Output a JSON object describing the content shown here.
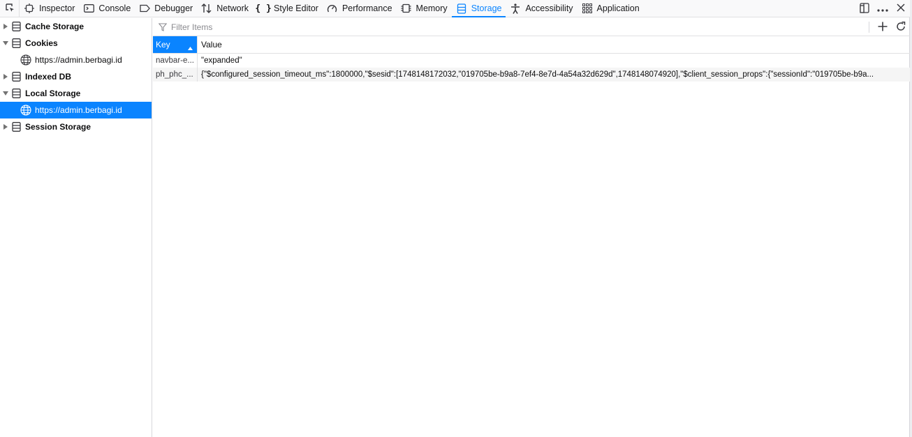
{
  "toolbar": {
    "tabs": [
      {
        "label": "Inspector",
        "icon": "inspector-icon"
      },
      {
        "label": "Console",
        "icon": "console-icon"
      },
      {
        "label": "Debugger",
        "icon": "debugger-icon"
      },
      {
        "label": "Network",
        "icon": "network-icon"
      },
      {
        "label": "Style Editor",
        "icon": "style-editor-icon"
      },
      {
        "label": "Performance",
        "icon": "performance-icon"
      },
      {
        "label": "Memory",
        "icon": "memory-icon"
      },
      {
        "label": "Storage",
        "icon": "storage-icon",
        "active": true
      },
      {
        "label": "Accessibility",
        "icon": "accessibility-icon"
      },
      {
        "label": "Application",
        "icon": "application-icon"
      }
    ],
    "accent_color": "#0a84ff"
  },
  "sidebar": {
    "cache_storage": "Cache Storage",
    "cookies": "Cookies",
    "cookies_child": "https://admin.berbagi.id",
    "indexed_db": "Indexed DB",
    "local_storage": "Local Storage",
    "local_storage_child": "https://admin.berbagi.id",
    "session_storage": "Session Storage"
  },
  "filter": {
    "placeholder": "Filter Items"
  },
  "table": {
    "columns": {
      "key": "Key",
      "value": "Value"
    },
    "rows": [
      {
        "key": "navbar-e...",
        "value": "\"expanded\""
      },
      {
        "key": "ph_phc_...",
        "value": "{\"$configured_session_timeout_ms\":1800000,\"$sesid\":[1748148172032,\"019705be-b9a8-7ef4-8e7d-4a54a32d629d\",1748148074920],\"$client_session_props\":{\"sessionId\":\"019705be-b9a..."
      }
    ]
  }
}
